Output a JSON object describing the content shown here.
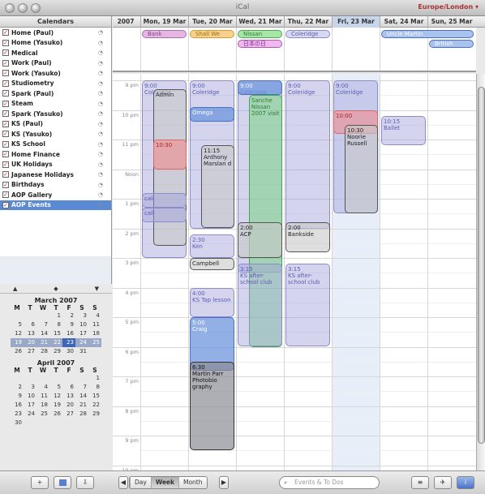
{
  "window": {
    "title": "iCal",
    "timezone": "Europe/London ▾"
  },
  "sidebar": {
    "header": "Calendars",
    "calendars": [
      {
        "label": "Home (Paul)",
        "selected": false
      },
      {
        "label": "Home (Yasuko)",
        "selected": false
      },
      {
        "label": "Medical",
        "selected": false
      },
      {
        "label": "Work (Paul)",
        "selected": false
      },
      {
        "label": "Work (Yasuko)",
        "selected": false
      },
      {
        "label": "Studiometry",
        "selected": false
      },
      {
        "label": "Spark (Paul)",
        "selected": false
      },
      {
        "label": "Steam",
        "selected": false
      },
      {
        "label": "Spark (Yasuko)",
        "selected": false
      },
      {
        "label": "KS (Paul)",
        "selected": false
      },
      {
        "label": "KS (Yasuko)",
        "selected": false
      },
      {
        "label": "KS School",
        "selected": false
      },
      {
        "label": "Home Finance",
        "selected": false
      },
      {
        "label": "UK Holidays",
        "selected": false
      },
      {
        "label": "Japanese Holidays",
        "selected": false
      },
      {
        "label": "Birthdays",
        "selected": false
      },
      {
        "label": "AOP Gallery",
        "selected": false
      },
      {
        "label": "AOP Events",
        "selected": true
      }
    ]
  },
  "minicalendar": {
    "nav": [
      "▲",
      "◆",
      "▼"
    ],
    "dow": [
      "M",
      "T",
      "W",
      "T",
      "F",
      "S",
      "S"
    ],
    "months": [
      {
        "name": "March 2007",
        "leading_blanks": 3,
        "days": 31
      },
      {
        "name": "April 2007",
        "leading_blanks": 6,
        "days": 30
      }
    ]
  },
  "header": {
    "year": "2007",
    "days": [
      "Mon, 19 Mar",
      "Tue, 20 Mar",
      "Wed, 21 Mar",
      "Thu, 22 Mar",
      "Fri, 23 Mar",
      "Sat, 24 Mar",
      "Sun, 25 Mar"
    ]
  },
  "allday_events": [
    {
      "label": "Bank",
      "day": 0,
      "row": 0,
      "color": "p"
    },
    {
      "label": "Shall We",
      "day": 1,
      "row": 0,
      "color": "o"
    },
    {
      "label": "Nissan",
      "day": 2,
      "row": 0,
      "color": "gr"
    },
    {
      "label": "Coleridge",
      "day": 3,
      "row": 0,
      "color": "lp"
    },
    {
      "label": "Uncle Martin",
      "day": 5,
      "row": 0,
      "color": "b",
      "span": 2
    },
    {
      "label": "日本の日",
      "day": 2,
      "row": 1,
      "color": "pk"
    },
    {
      "label": "British",
      "day": 6,
      "row": 1,
      "color": "b"
    }
  ],
  "hours": [
    "9 pm",
    "10 pm",
    "11 pm",
    "Noon",
    "1 pm",
    "2 pm",
    "3 pm",
    "4 pm",
    "5 pm",
    "6 pm",
    "7 pm",
    "8 pm",
    "9 pm",
    "10 pm"
  ],
  "events": [
    {
      "text": "9:00\nColeridge",
      "day": 0,
      "start": 9.0,
      "end": 15.0,
      "style": "p",
      "sub": 0
    },
    {
      "text": "Admin",
      "day": 0,
      "start": 9.3,
      "end": 14.6,
      "style": "g",
      "sub": 1
    },
    {
      "text": "10:30",
      "day": 0,
      "start": 11.0,
      "end": 12.0,
      "style": "r",
      "sub": 1
    },
    {
      "text": "call",
      "day": 0,
      "start": 12.8,
      "end": 13.3,
      "style": "p",
      "sub": 0
    },
    {
      "text": "call",
      "day": 0,
      "start": 13.3,
      "end": 13.8,
      "style": "p",
      "sub": 0
    },
    {
      "text": "9:00\nColeridge",
      "day": 1,
      "start": 9.0,
      "end": 14.0,
      "style": "p",
      "sub": 0
    },
    {
      "text": "Omega",
      "day": 1,
      "start": 9.9,
      "end": 10.4,
      "style": "b",
      "sub": 0
    },
    {
      "text": "11:15\nAnthony Marslan d",
      "day": 1,
      "start": 11.2,
      "end": 14.0,
      "style": "g",
      "sub": 1
    },
    {
      "text": "2:30\nKen",
      "day": 1,
      "start": 14.2,
      "end": 15.0,
      "style": "p",
      "sub": 0
    },
    {
      "text": "Campbell",
      "day": 1,
      "start": 15.0,
      "end": 15.4,
      "style": "g",
      "sub": 0
    },
    {
      "text": "4:00\nKS Tap lesson",
      "day": 1,
      "start": 16.0,
      "end": 17.0,
      "style": "p",
      "sub": 0
    },
    {
      "text": "5:00\nCraig",
      "day": 1,
      "start": 17.0,
      "end": 18.8,
      "style": "b",
      "sub": 0
    },
    {
      "text": "6:30\nMartin Parr Photobio graphy",
      "day": 1,
      "start": 18.5,
      "end": 21.5,
      "style": "dk",
      "sub": 0
    },
    {
      "text": "9:00\nColeridge",
      "day": 2,
      "start": 9.0,
      "end": 15.5,
      "style": "p",
      "sub": 0
    },
    {
      "text": "Sanche Nissan 2007 visit",
      "day": 2,
      "start": 9.5,
      "end": 18.0,
      "style": "gr",
      "sub": 1
    },
    {
      "text": "9:00",
      "day": 2,
      "start": 9.0,
      "end": 9.5,
      "style": "b",
      "sub": 0
    },
    {
      "text": "2:00\nACP",
      "day": 2,
      "start": 13.8,
      "end": 15.0,
      "style": "g",
      "sub": 0
    },
    {
      "text": "3:15\nKS after-school club",
      "day": 2,
      "start": 15.2,
      "end": 18.0,
      "style": "p",
      "sub": 0
    },
    {
      "text": "9:00\nColeridge",
      "day": 3,
      "start": 9.0,
      "end": 14.0,
      "style": "p",
      "sub": 0
    },
    {
      "text": "2:00\nBankside",
      "day": 3,
      "start": 13.8,
      "end": 14.8,
      "style": "g",
      "sub": 0
    },
    {
      "text": "3:15\nKS after-school club",
      "day": 3,
      "start": 15.2,
      "end": 18.0,
      "style": "p",
      "sub": 0
    },
    {
      "text": "9:00\nColeridge",
      "day": 4,
      "start": 9.0,
      "end": 13.5,
      "style": "p",
      "sub": 0
    },
    {
      "text": "10:00",
      "day": 4,
      "start": 10.0,
      "end": 10.8,
      "style": "r",
      "sub": 0
    },
    {
      "text": "10:30\nNoorie Russell",
      "day": 4,
      "start": 10.5,
      "end": 13.5,
      "style": "g",
      "sub": 1
    },
    {
      "text": "10:15\nBallet",
      "day": 5,
      "start": 10.2,
      "end": 11.2,
      "style": "p",
      "sub": 0
    }
  ],
  "footer": {
    "views": [
      "Day",
      "Week",
      "Month"
    ],
    "active_view": "Week",
    "search_placeholder": "Events & To Dos"
  }
}
